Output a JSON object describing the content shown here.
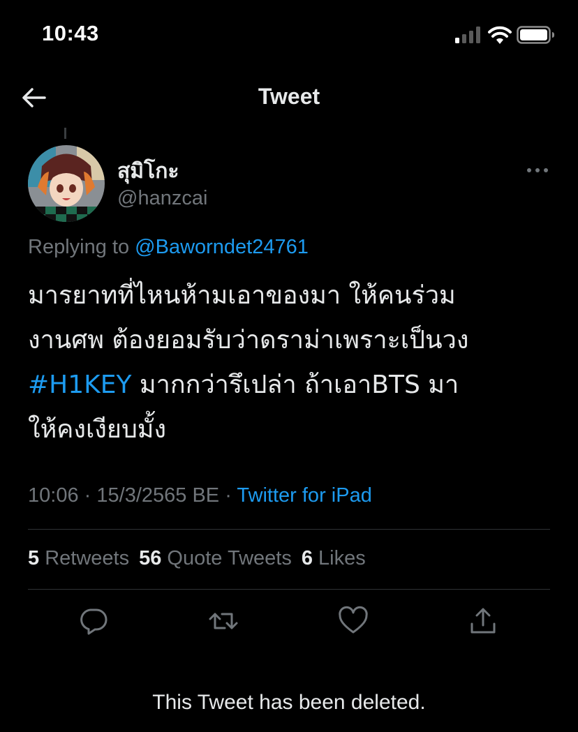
{
  "status_bar": {
    "time": "10:43"
  },
  "nav": {
    "title": "Tweet",
    "back_icon": "arrow-left-icon"
  },
  "author": {
    "display_name": "สุมิโกะ",
    "handle": "@hanzcai"
  },
  "tweet": {
    "replying_prefix": "Replying to",
    "replying_to": "@Baworndet24761",
    "line1": "มารยาทที่ไหนห้ามเอาของมา ให้คนร่วม",
    "line2": "งานศพ ต้องยอมรับว่าดราม่าเพราะเป็นวง",
    "hashtag": "#H1KEY",
    "line3_rest": " มากกว่ารึเปล่า ถ้าเอาBTS มา",
    "line4": "ให้คงเงียบมั้ง",
    "time": "10:06",
    "date": "15/3/2565 BE",
    "separator": "·",
    "source": "Twitter for iPad"
  },
  "stats": {
    "retweets_count": "5",
    "retweets_label": "Retweets",
    "quotes_count": "56",
    "quotes_label": "Quote Tweets",
    "likes_count": "6",
    "likes_label": "Likes"
  },
  "actions": {
    "reply_icon": "reply-icon",
    "retweet_icon": "retweet-icon",
    "like_icon": "heart-icon",
    "share_icon": "share-icon"
  },
  "deleted_notice": "This Tweet has been deleted.",
  "colors": {
    "background": "#000000",
    "text": "#e7e9ea",
    "secondary": "#71767b",
    "accent": "#1d9bf0",
    "divider": "#2f3336"
  }
}
